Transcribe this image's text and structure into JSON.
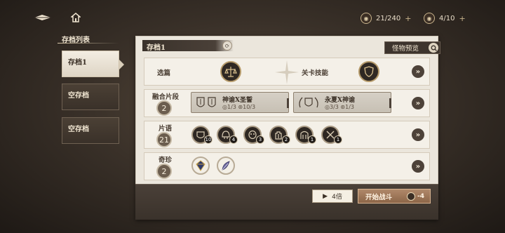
{
  "resources": {
    "energy": {
      "value": "21/240",
      "icon": "energy-coin-icon",
      "plus": "+"
    },
    "ticket": {
      "value": "4/10",
      "icon": "ticket-coin-icon",
      "plus": "+"
    }
  },
  "sidebar": {
    "title": "存档列表",
    "slots": [
      {
        "label": "存档1",
        "active": true
      },
      {
        "label": "空存档",
        "active": false
      },
      {
        "label": "空存档",
        "active": false
      }
    ]
  },
  "panel": {
    "title": "存档1",
    "monster_preview": "怪物预览",
    "select_chapter": "选篇",
    "stage_skill": "关卡技能",
    "fusion": {
      "label": "融合片段",
      "count": "2",
      "items": [
        {
          "name": "神谕X圣誓",
          "stat1": "1/3",
          "stat2": "10/3"
        },
        {
          "name": "永夏X神谕",
          "stat1": "3/3",
          "stat2": "1/3"
        }
      ]
    },
    "phrases": {
      "label": "片语",
      "count": "21",
      "items": [
        {
          "icon": "crest-icon",
          "count": "10"
        },
        {
          "icon": "helmet-icon",
          "count": "4"
        },
        {
          "icon": "mask-icon",
          "count": "3"
        },
        {
          "icon": "tower-icon",
          "count": "2"
        },
        {
          "icon": "gate-icon",
          "count": "1"
        },
        {
          "icon": "crossed-swords-icon",
          "count": "1"
        }
      ]
    },
    "treasures": {
      "label": "奇珍",
      "count": "2",
      "items": [
        {
          "icon": "gem-icon"
        },
        {
          "icon": "feather-icon"
        }
      ]
    },
    "speed": "4倍",
    "start": "开始战斗",
    "start_cost": "-4"
  },
  "colors": {
    "accent": "#8c6548",
    "panel": "#ebe6dc",
    "dark": "#3a322b"
  }
}
